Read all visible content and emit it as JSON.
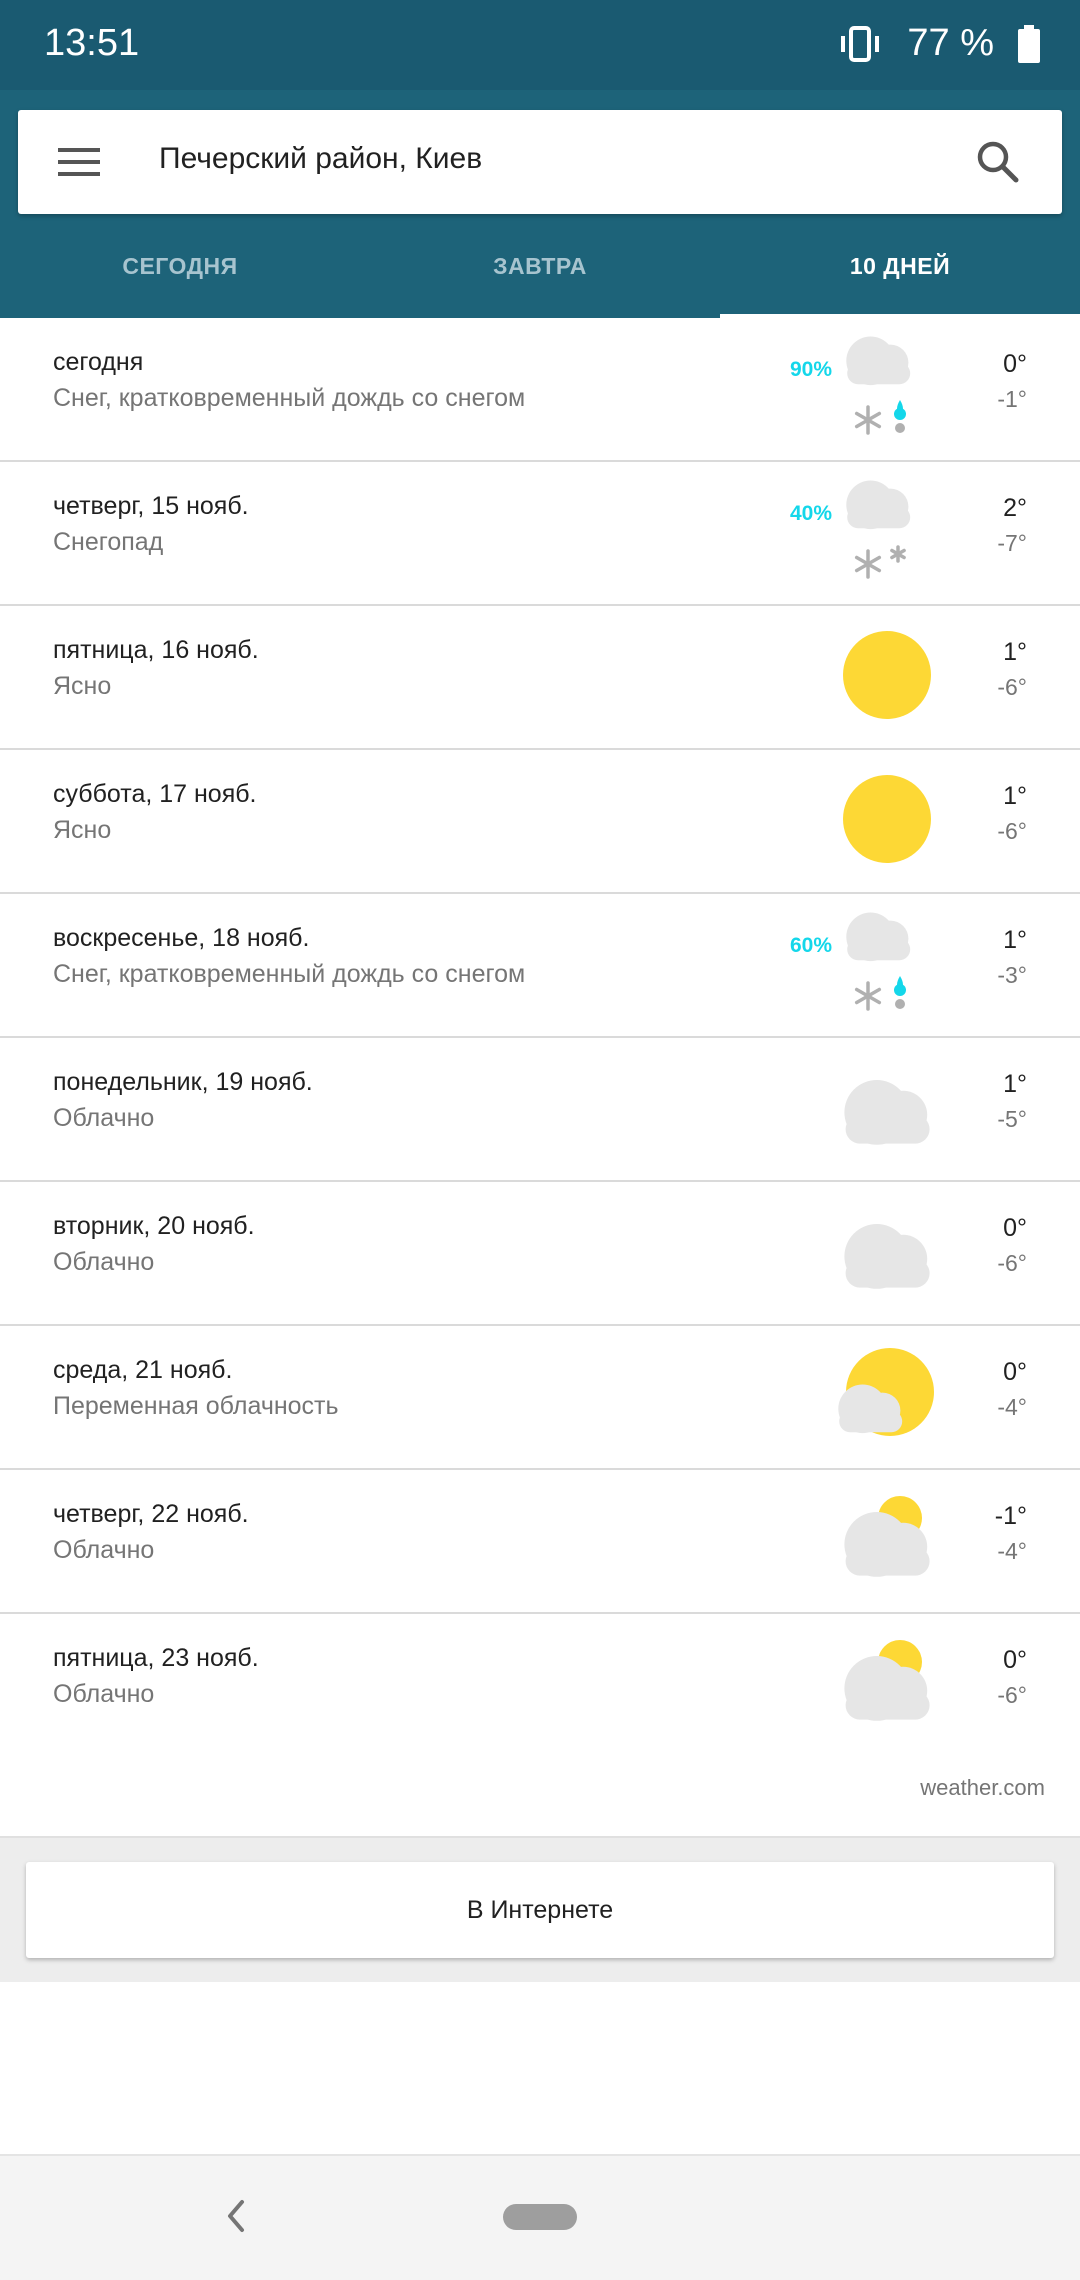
{
  "status_bar": {
    "time": "13:51",
    "battery": "77 %",
    "icons": [
      "vibrate-icon",
      "battery-icon"
    ]
  },
  "header": {
    "location": "Печерский район, Киев",
    "icons": [
      "menu-icon",
      "search-icon"
    ]
  },
  "tabs": [
    {
      "label": "СЕГОДНЯ",
      "active": false
    },
    {
      "label": "ЗАВТРА",
      "active": false
    },
    {
      "label": "10 ДНЕЙ",
      "active": true
    }
  ],
  "forecast": [
    {
      "day": "сегодня",
      "condition": "Снег, кратковременный дождь со снегом",
      "precip": "90%",
      "icon": "snow-rain-icon",
      "high": "0°",
      "low": "-1°"
    },
    {
      "day": "четверг, 15 нояб.",
      "condition": "Снегопад",
      "precip": "40%",
      "icon": "snow-icon",
      "high": "2°",
      "low": "-7°"
    },
    {
      "day": "пятница, 16 нояб.",
      "condition": "Ясно",
      "precip": "",
      "icon": "sun-icon",
      "high": "1°",
      "low": "-6°"
    },
    {
      "day": "суббота, 17 нояб.",
      "condition": "Ясно",
      "precip": "",
      "icon": "sun-icon",
      "high": "1°",
      "low": "-6°"
    },
    {
      "day": "воскресенье, 18 нояб.",
      "condition": "Снег, кратковременный дождь со снегом",
      "precip": "60%",
      "icon": "snow-rain-icon",
      "high": "1°",
      "low": "-3°"
    },
    {
      "day": "понедельник, 19 нояб.",
      "condition": "Облачно",
      "precip": "",
      "icon": "cloud-icon",
      "high": "1°",
      "low": "-5°"
    },
    {
      "day": "вторник, 20 нояб.",
      "condition": "Облачно",
      "precip": "",
      "icon": "cloud-icon",
      "high": "0°",
      "low": "-6°"
    },
    {
      "day": "среда, 21 нояб.",
      "condition": "Переменная облачность",
      "precip": "",
      "icon": "partly-cloudy-icon",
      "high": "0°",
      "low": "-4°"
    },
    {
      "day": "четверг, 22 нояб.",
      "condition": "Облачно",
      "precip": "",
      "icon": "mostly-cloudy-icon",
      "high": "-1°",
      "low": "-4°"
    },
    {
      "day": "пятница, 23 нояб.",
      "condition": "Облачно",
      "precip": "",
      "icon": "mostly-cloudy-icon",
      "high": "0°",
      "low": "-6°"
    }
  ],
  "attribution": "weather.com",
  "online_button": "В Интернете",
  "nav": {
    "icons": [
      "back-icon",
      "home-pill"
    ]
  },
  "colors": {
    "status_bar": "#1a5a71",
    "header": "#1d6379",
    "precip": "#14d7ea",
    "sun": "#fdd835",
    "cloud": "#e6e6e6",
    "snow": "#b0b0b0",
    "rain_drop": "#14d7ea"
  }
}
